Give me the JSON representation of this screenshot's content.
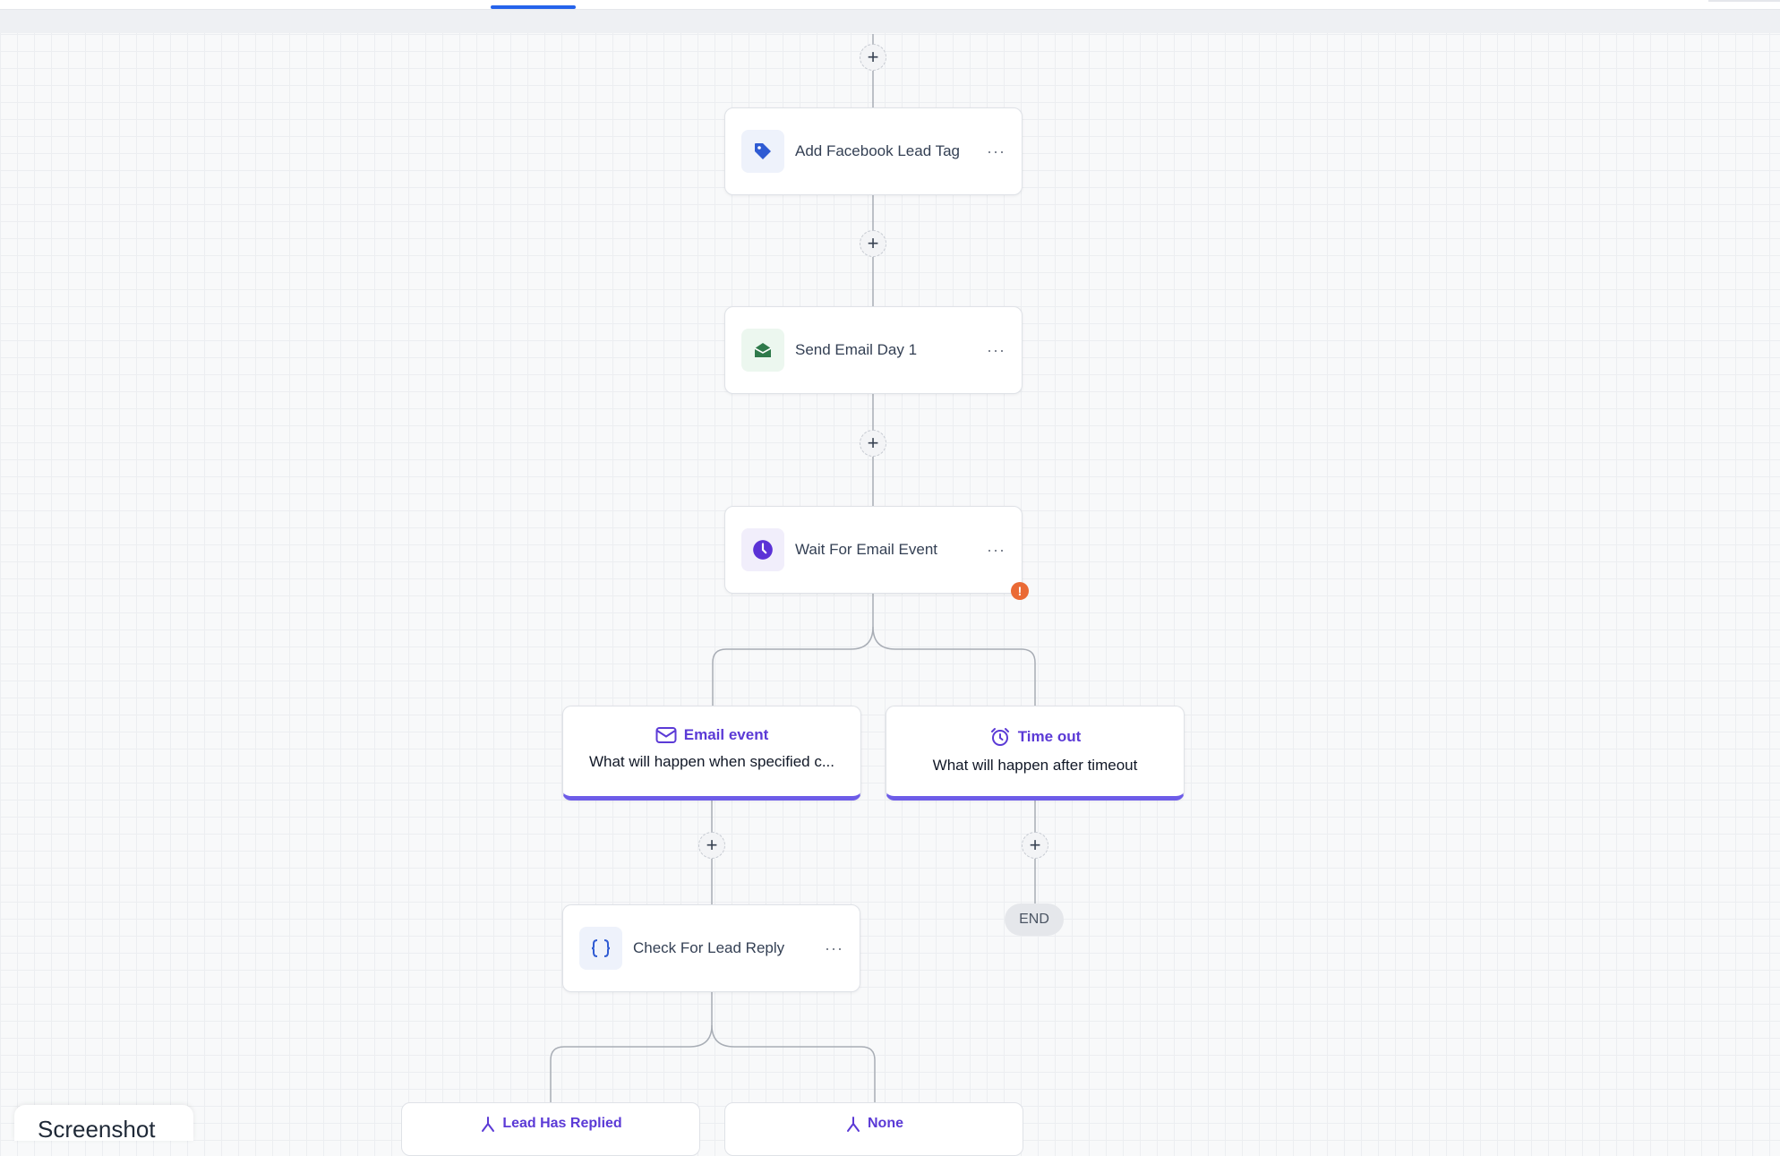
{
  "canvas": {
    "nodes": [
      {
        "label": "Add Facebook Lead Tag",
        "icon": "tag-icon"
      },
      {
        "label": "Send Email Day 1",
        "icon": "envelope-open-icon"
      },
      {
        "label": "Wait For Email Event",
        "icon": "clock-icon"
      },
      {
        "label": "Check For Lead Reply",
        "icon": "braces-icon"
      }
    ],
    "menu_glyph": "···",
    "add_glyph": "+",
    "warning_glyph": "!",
    "branches": [
      {
        "title": "Email event",
        "description": "What will happen when specified c...",
        "icon": "mail-icon"
      },
      {
        "title": "Time out",
        "description": "What will happen after timeout",
        "icon": "alarm-clock-icon"
      }
    ],
    "condition_branches": [
      {
        "title": "Lead Has Replied",
        "icon": "split-icon"
      },
      {
        "title": "None",
        "icon": "split-icon"
      }
    ],
    "end_label": "END"
  },
  "overlay": {
    "label": "Screenshot"
  },
  "colors": {
    "accent": "#2563eb",
    "branch_accent": "#6d5ce8",
    "branch_title": "#5b3ad6",
    "tag_blue": "#2f5bd3",
    "email_green": "#2f7a4b",
    "clock_purple": "#5b32d6",
    "warning": "#ea6a35"
  }
}
